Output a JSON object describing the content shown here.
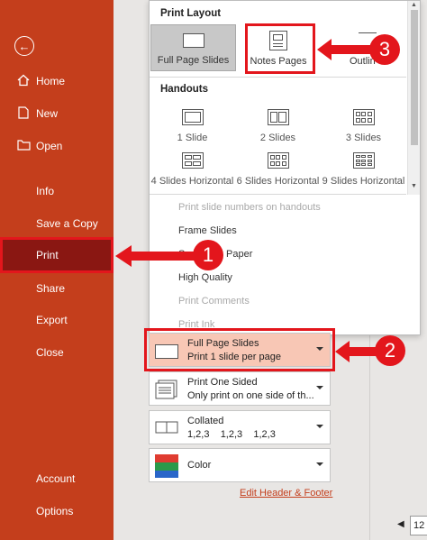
{
  "sidebar": {
    "items": [
      {
        "label": "Home"
      },
      {
        "label": "New"
      },
      {
        "label": "Open"
      },
      {
        "label": "Info"
      },
      {
        "label": "Save a Copy"
      },
      {
        "label": "Print"
      },
      {
        "label": "Share"
      },
      {
        "label": "Export"
      },
      {
        "label": "Close"
      }
    ],
    "bottom": [
      {
        "label": "Account"
      },
      {
        "label": "Options"
      }
    ]
  },
  "menu": {
    "print_layout_heading": "Print Layout",
    "layouts": [
      {
        "label": "Full Page Slides",
        "selected": true
      },
      {
        "label": "Notes Pages"
      },
      {
        "label": "Outlin"
      }
    ],
    "handouts_heading": "Handouts",
    "handouts": [
      {
        "label": "1 Slide"
      },
      {
        "label": "2 Slides"
      },
      {
        "label": "3 Slides"
      },
      {
        "label": "4 Slides Horizontal"
      },
      {
        "label": "6 Slides Horizontal"
      },
      {
        "label": "9 Slides Horizontal"
      }
    ],
    "options": [
      {
        "label": "Print slide numbers on handouts",
        "enabled": false
      },
      {
        "label": "Frame Slides",
        "enabled": true
      },
      {
        "label": "Sc",
        "enabled": true
      },
      {
        "label": "Paper",
        "enabled": true
      },
      {
        "label": "High Quality",
        "enabled": true
      },
      {
        "label": "Print Comments",
        "enabled": false
      },
      {
        "label": "Print Ink",
        "enabled": false
      }
    ]
  },
  "dropdowns": {
    "layout": {
      "line1": "Full Page Slides",
      "line2": "Print 1 slide per page"
    },
    "sides": {
      "line1": "Print One Sided",
      "line2": "Only print on one side of th..."
    },
    "collate": {
      "line1": "Collated",
      "line2": "1,2,3    1,2,3    1,2,3"
    },
    "color": {
      "line1": "Color"
    }
  },
  "edit_header_footer": "Edit Header & Footer",
  "page_number": "12",
  "callouts": [
    "1",
    "2",
    "3"
  ],
  "colors": {
    "accent": "#c43e1c",
    "callout": "#e3161c",
    "active": "#8a1712"
  }
}
